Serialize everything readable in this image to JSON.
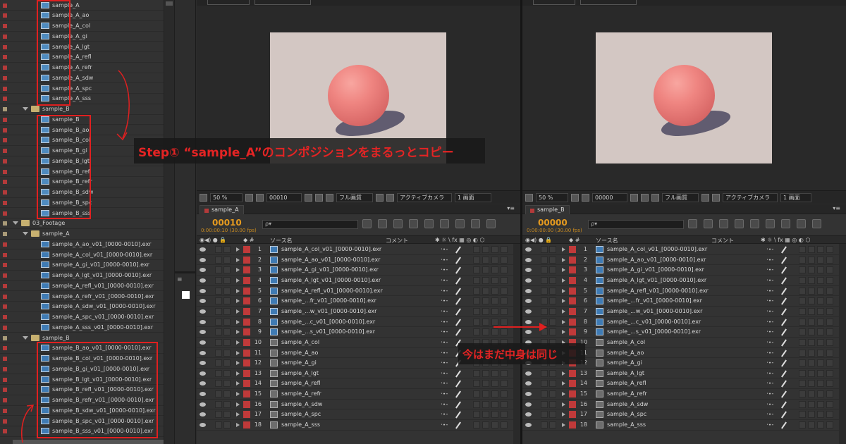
{
  "project_panel": {
    "rows": [
      {
        "name": "sample_A",
        "kind": "comp",
        "indent": 58,
        "label": "red"
      },
      {
        "name": "sample_A_ao",
        "kind": "comp",
        "indent": 58,
        "label": "red"
      },
      {
        "name": "sample_A_col",
        "kind": "comp",
        "indent": 58,
        "label": "red"
      },
      {
        "name": "sample_A_gi",
        "kind": "comp",
        "indent": 58,
        "label": "red"
      },
      {
        "name": "sample_A_lgt",
        "kind": "comp",
        "indent": 58,
        "label": "red"
      },
      {
        "name": "sample_A_refl",
        "kind": "comp",
        "indent": 58,
        "label": "red"
      },
      {
        "name": "sample_A_refr",
        "kind": "comp",
        "indent": 58,
        "label": "red"
      },
      {
        "name": "sample_A_sdw",
        "kind": "comp",
        "indent": 58,
        "label": "red"
      },
      {
        "name": "sample_A_spc",
        "kind": "comp",
        "indent": 58,
        "label": "red"
      },
      {
        "name": "sample_A_sss",
        "kind": "comp",
        "indent": 58,
        "label": "red"
      },
      {
        "name": "sample_B",
        "kind": "folder",
        "indent": 32,
        "label": "tan"
      },
      {
        "name": "sample_B",
        "kind": "comp",
        "indent": 58,
        "label": "red"
      },
      {
        "name": "sample_B_ao",
        "kind": "comp",
        "indent": 58,
        "label": "red"
      },
      {
        "name": "sample_B_col",
        "kind": "comp",
        "indent": 58,
        "label": "red"
      },
      {
        "name": "sample_B_gi",
        "kind": "comp",
        "indent": 58,
        "label": "red"
      },
      {
        "name": "sample_B_lgt",
        "kind": "comp",
        "indent": 58,
        "label": "red"
      },
      {
        "name": "sample_B_refl",
        "kind": "comp",
        "indent": 58,
        "label": "red"
      },
      {
        "name": "sample_B_refr",
        "kind": "comp",
        "indent": 58,
        "label": "red"
      },
      {
        "name": "sample_B_sdw",
        "kind": "comp",
        "indent": 58,
        "label": "red"
      },
      {
        "name": "sample_B_spc",
        "kind": "comp",
        "indent": 58,
        "label": "red"
      },
      {
        "name": "sample_B_sss",
        "kind": "comp",
        "indent": 58,
        "label": "red"
      },
      {
        "name": "03_Footage",
        "kind": "folder",
        "indent": 18,
        "label": "tan"
      },
      {
        "name": "sample_A",
        "kind": "folder",
        "indent": 32,
        "label": "tan"
      },
      {
        "name": "sample_A_ao_v01_[0000-0010].exr",
        "kind": "footage",
        "indent": 58,
        "label": "red"
      },
      {
        "name": "sample_A_col_v01_[0000-0010].exr",
        "kind": "footage",
        "indent": 58,
        "label": "red"
      },
      {
        "name": "sample_A_gi_v01_[0000-0010].exr",
        "kind": "footage",
        "indent": 58,
        "label": "red"
      },
      {
        "name": "sample_A_lgt_v01_[0000-0010].exr",
        "kind": "footage",
        "indent": 58,
        "label": "red"
      },
      {
        "name": "sample_A_refl_v01_[0000-0010].exr",
        "kind": "footage",
        "indent": 58,
        "label": "red"
      },
      {
        "name": "sample_A_refr_v01_[0000-0010].exr",
        "kind": "footage",
        "indent": 58,
        "label": "red"
      },
      {
        "name": "sample_A_sdw_v01_[0000-0010].exr",
        "kind": "footage",
        "indent": 58,
        "label": "red"
      },
      {
        "name": "sample_A_spc_v01_[0000-0010].exr",
        "kind": "footage",
        "indent": 58,
        "label": "red"
      },
      {
        "name": "sample_A_sss_v01_[0000-0010].exr",
        "kind": "footage",
        "indent": 58,
        "label": "red"
      },
      {
        "name": "sample_B",
        "kind": "folder",
        "indent": 32,
        "label": "tan"
      },
      {
        "name": "sample_B_ao_v01_[0000-0010].exr",
        "kind": "footage",
        "indent": 58,
        "label": "red"
      },
      {
        "name": "sample_B_col_v01_[0000-0010].exr",
        "kind": "footage",
        "indent": 58,
        "label": "red"
      },
      {
        "name": "sample_B_gi_v01_[0000-0010].exr",
        "kind": "footage",
        "indent": 58,
        "label": "red"
      },
      {
        "name": "sample_B_lgt_v01_[0000-0010].exr",
        "kind": "footage",
        "indent": 58,
        "label": "red"
      },
      {
        "name": "sample_B_refl_v01_[0000-0010].exr",
        "kind": "footage",
        "indent": 58,
        "label": "red"
      },
      {
        "name": "sample_B_refr_v01_[0000-0010].exr",
        "kind": "footage",
        "indent": 58,
        "label": "red"
      },
      {
        "name": "sample_B_sdw_v01_[0000-0010].exr",
        "kind": "footage",
        "indent": 58,
        "label": "red"
      },
      {
        "name": "sample_B_spc_v01_[0000-0010].exr",
        "kind": "footage",
        "indent": 58,
        "label": "red"
      },
      {
        "name": "sample_B_sss_v01_[0000-0010].exr",
        "kind": "footage",
        "indent": 58,
        "label": "red"
      }
    ]
  },
  "viewer_a": {
    "zoom": "50 %",
    "frame": "00010",
    "quality": "フル画質",
    "camera": "アクティブカメラ",
    "view": "1 画面"
  },
  "viewer_b": {
    "zoom": "50 %",
    "frame": "00000",
    "quality": "フル画質",
    "camera": "アクティブカメラ",
    "view": "1 画面"
  },
  "timeline_a": {
    "tab": "sample_A",
    "timecode": "00010",
    "fps": "0:00:00:10 (30.00 fps)",
    "search_placeholder": "ρ▾",
    "col_source": "ソース名",
    "col_comment": "コメント",
    "layers": [
      {
        "num": "1",
        "name": "sample_A_col_v01_[0000-0010].exr",
        "kind": "footage"
      },
      {
        "num": "2",
        "name": "sample_A_ao_v01_[0000-0010].exr",
        "kind": "footage"
      },
      {
        "num": "3",
        "name": "sample_A_gi_v01_[0000-0010].exr",
        "kind": "footage"
      },
      {
        "num": "4",
        "name": "sample_A_lgt_v01_[0000-0010].exr",
        "kind": "footage"
      },
      {
        "num": "5",
        "name": "sample_A_refl_v01_[0000-0010].exr",
        "kind": "footage"
      },
      {
        "num": "6",
        "name": "sample_...fr_v01_[0000-0010].exr",
        "kind": "footage"
      },
      {
        "num": "7",
        "name": "sample_...w_v01_[0000-0010].exr",
        "kind": "footage"
      },
      {
        "num": "8",
        "name": "sample_...c_v01_[0000-0010].exr",
        "kind": "footage"
      },
      {
        "num": "9",
        "name": "sample_...s_v01_[0000-0010].exr",
        "kind": "footage"
      },
      {
        "num": "10",
        "name": "sample_A_col",
        "kind": "comp"
      },
      {
        "num": "11",
        "name": "sample_A_ao",
        "kind": "comp"
      },
      {
        "num": "12",
        "name": "sample_A_gi",
        "kind": "comp"
      },
      {
        "num": "13",
        "name": "sample_A_lgt",
        "kind": "comp"
      },
      {
        "num": "14",
        "name": "sample_A_refl",
        "kind": "comp"
      },
      {
        "num": "15",
        "name": "sample_A_refr",
        "kind": "comp"
      },
      {
        "num": "16",
        "name": "sample_A_sdw",
        "kind": "comp"
      },
      {
        "num": "17",
        "name": "sample_A_spc",
        "kind": "comp"
      },
      {
        "num": "18",
        "name": "sample_A_sss",
        "kind": "comp"
      }
    ]
  },
  "timeline_b": {
    "tab": "sample_B",
    "timecode": "00000",
    "fps": "0:00:00:00 (30.00 fps)",
    "search_placeholder": "ρ▾",
    "col_source": "ソース名",
    "col_comment": "コメント",
    "layers": [
      {
        "num": "1",
        "name": "sample_A_col_v01_[0000-0010].exr",
        "kind": "footage"
      },
      {
        "num": "2",
        "name": "sample_A_ao_v01_[0000-0010].exr",
        "kind": "footage"
      },
      {
        "num": "3",
        "name": "sample_A_gi_v01_[0000-0010].exr",
        "kind": "footage"
      },
      {
        "num": "4",
        "name": "sample_A_lgt_v01_[0000-0010].exr",
        "kind": "footage"
      },
      {
        "num": "5",
        "name": "sample_A_refl_v01_[0000-0010].exr",
        "kind": "footage"
      },
      {
        "num": "6",
        "name": "sample_...fr_v01_[0000-0010].exr",
        "kind": "footage"
      },
      {
        "num": "7",
        "name": "sample_...w_v01_[0000-0010].exr",
        "kind": "footage"
      },
      {
        "num": "8",
        "name": "sample_...c_v01_[0000-0010].exr",
        "kind": "footage"
      },
      {
        "num": "9",
        "name": "sample_...s_v01_[0000-0010].exr",
        "kind": "footage"
      },
      {
        "num": "10",
        "name": "sample_A_col",
        "kind": "comp"
      },
      {
        "num": "11",
        "name": "sample_A_ao",
        "kind": "comp"
      },
      {
        "num": "12",
        "name": "sample_A_gi",
        "kind": "comp"
      },
      {
        "num": "13",
        "name": "sample_A_lgt",
        "kind": "comp"
      },
      {
        "num": "14",
        "name": "sample_A_refl",
        "kind": "comp"
      },
      {
        "num": "15",
        "name": "sample_A_refr",
        "kind": "comp"
      },
      {
        "num": "16",
        "name": "sample_A_sdw",
        "kind": "comp"
      },
      {
        "num": "17",
        "name": "sample_A_spc",
        "kind": "comp"
      },
      {
        "num": "18",
        "name": "sample_A_sss",
        "kind": "comp"
      }
    ]
  },
  "annotations": {
    "step": "Step① “sample_A”のコンポジションをまるっとコピー",
    "note": "今はまだ中身は同じ"
  },
  "colors": {
    "annotation_red": "#e42424",
    "label_red": "#c03a3a",
    "timecode_orange": "#e59a1f",
    "render_bg": "#d3c7c3",
    "sphere": "#ef8581"
  }
}
